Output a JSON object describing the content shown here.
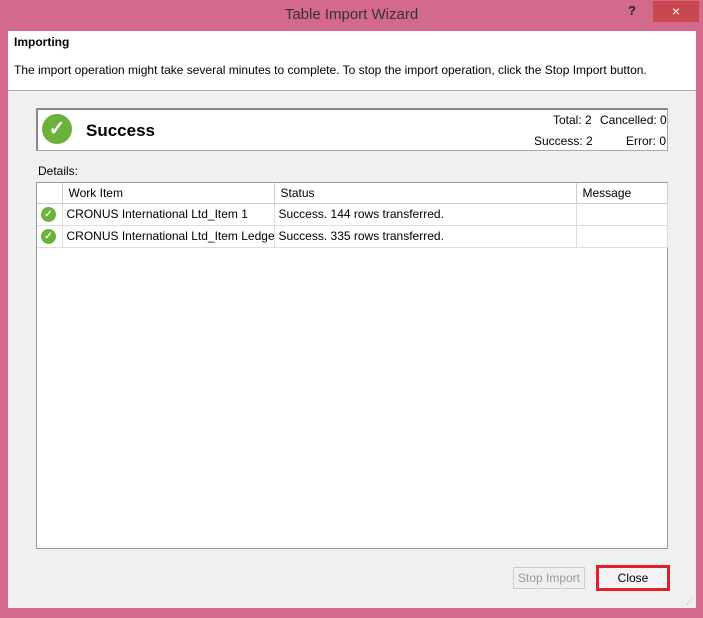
{
  "window": {
    "title": "Table Import Wizard",
    "help": "?",
    "close": "×"
  },
  "header": {
    "title": "Importing",
    "description": "The import operation might take several minutes to complete. To stop the import operation, click the Stop Import button."
  },
  "summary": {
    "status": "Success",
    "total": "Total: 2",
    "cancelled": "Cancelled: 0",
    "success": "Success: 2",
    "error": "Error: 0",
    "status_icon": "check-circle",
    "status_color": "#6ab23a"
  },
  "details": {
    "label": "Details:",
    "columns": [
      "",
      "Work Item",
      "Status",
      "Message"
    ],
    "rows": [
      {
        "work_item": "CRONUS International Ltd_Item 1",
        "status": "Success. 144 rows transferred.",
        "message": ""
      },
      {
        "work_item": "CRONUS International Ltd_Item Ledger ...",
        "status": "Success. 335 rows transferred.",
        "message": ""
      }
    ]
  },
  "buttons": {
    "stop_import": "Stop Import",
    "close": "Close"
  }
}
